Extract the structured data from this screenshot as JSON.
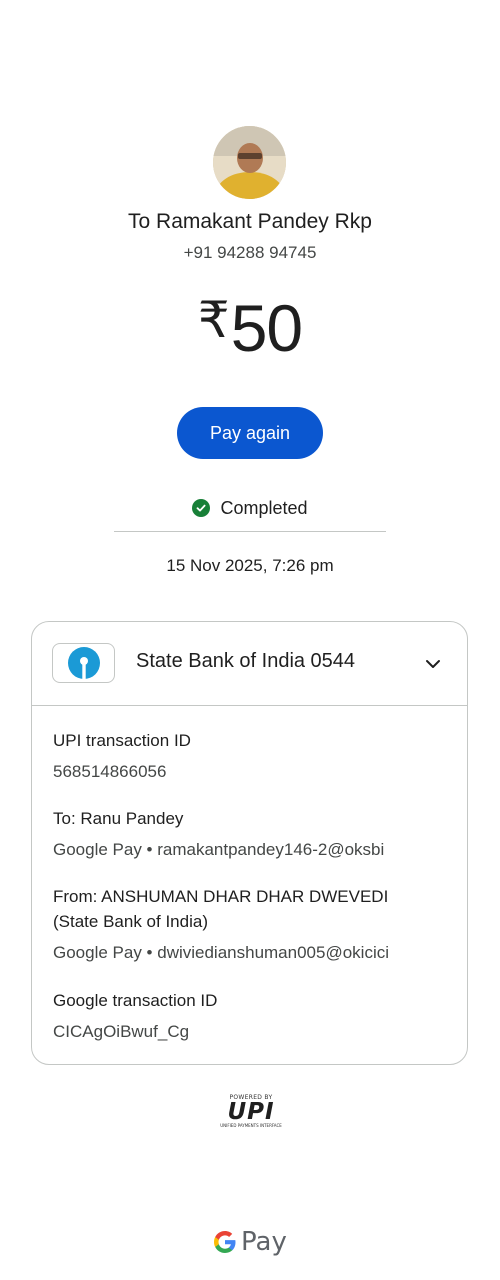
{
  "recipient": {
    "name": "To Ramakant Pandey Rkp",
    "phone": "+91 94288 94745"
  },
  "amount": {
    "currency_symbol": "₹",
    "value": "50"
  },
  "actions": {
    "pay_again_label": "Pay again"
  },
  "status": {
    "label": "Completed",
    "color": "#188038"
  },
  "timestamp": "15 Nov 2025, 7:26 pm",
  "bank": {
    "name": "State Bank of India 0544",
    "logo_icon": "sbi-logo-icon"
  },
  "details": {
    "upi_id_label": "UPI transaction ID",
    "upi_id_value": "568514866056",
    "to_label": "To: Ranu  Pandey",
    "to_value": "Google Pay • ramakantpandey146-2@oksbi",
    "from_label_line1": "From: ANSHUMAN DHAR DHAR DWEVEDI",
    "from_label_line2": "(State Bank of India)",
    "from_value": "Google Pay • dwiviedianshuman005@okicici",
    "google_id_label": "Google transaction ID",
    "google_id_value": "CICAgOiBwuf_Cg"
  },
  "footer": {
    "powered_by": "POWERED BY",
    "upi_logo_text": "UPI",
    "upi_subtext": "UNIFIED PAYMENTS INTERFACE",
    "gpay_text": "Pay"
  },
  "colors": {
    "accent": "#0b57d0",
    "border": "#c4c7c5",
    "text_secondary": "#444746"
  }
}
